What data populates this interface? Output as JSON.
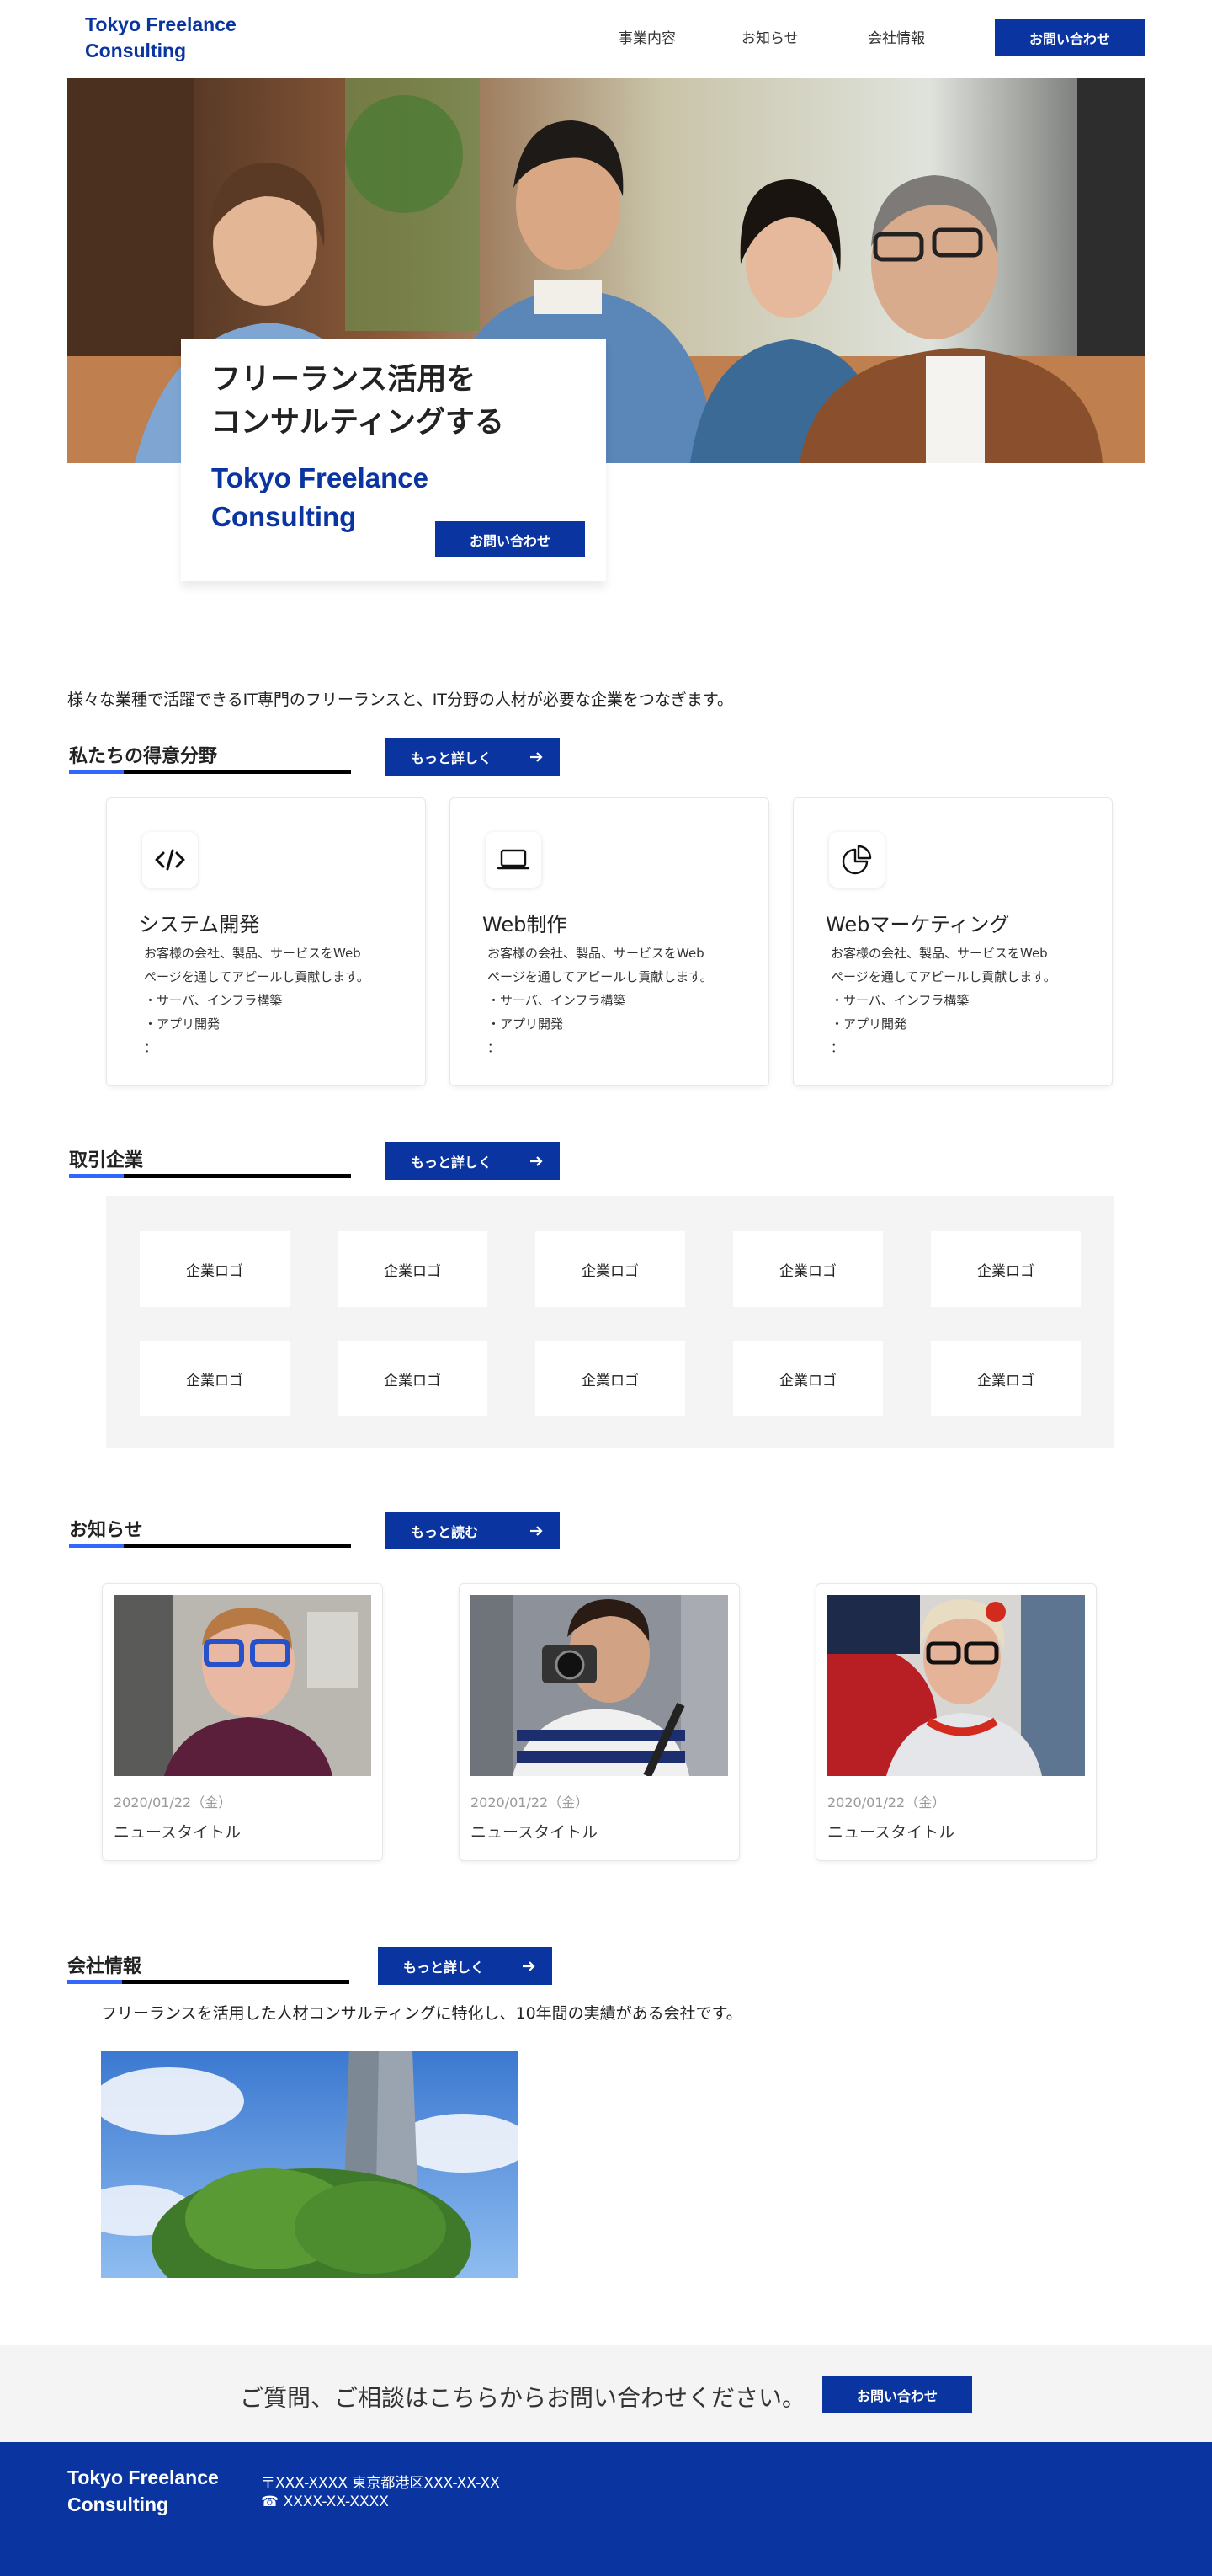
{
  "header": {
    "brand_line1": "Tokyo Freelance",
    "brand_line2": "Consulting",
    "nav": [
      "事業内容",
      "お知らせ",
      "会社情報"
    ],
    "contact_button": "お問い合わせ"
  },
  "hero": {
    "headline_line1": "フリーランス活用を",
    "headline_line2": "コンサルティングする",
    "brand_line1": "Tokyo Freelance",
    "brand_line2": "Consulting",
    "contact_button": "お問い合わせ"
  },
  "intro": "様々な業種で活躍できるIT専門のフリーランスと、IT分野の人材が必要な企業をつなぎます。",
  "services": {
    "title": "私たちの得意分野",
    "more_button": "もっと詳しく",
    "items": [
      {
        "icon": "code-icon",
        "title": "システム開発",
        "desc1": "お客様の会社、製品、サービスをWeb",
        "desc2": "ページを通してアピールし貢献します。",
        "bullet1": "・サーバ、インフラ構築",
        "bullet2": "・アプリ開発",
        "more": "："
      },
      {
        "icon": "laptop-icon",
        "title": "Web制作",
        "desc1": "お客様の会社、製品、サービスをWeb",
        "desc2": "ページを通してアピールし貢献します。",
        "bullet1": "・サーバ、インフラ構築",
        "bullet2": "・アプリ開発",
        "more": "："
      },
      {
        "icon": "pie-chart-icon",
        "title": "Webマーケティング",
        "desc1": "お客様の会社、製品、サービスをWeb",
        "desc2": "ページを通してアピールし貢献します。",
        "bullet1": "・サーバ、インフラ構築",
        "bullet2": "・アプリ開発",
        "more": "："
      }
    ]
  },
  "clients": {
    "title": "取引企業",
    "more_button": "もっと詳しく",
    "logos": [
      "企業ロゴ",
      "企業ロゴ",
      "企業ロゴ",
      "企業ロゴ",
      "企業ロゴ",
      "企業ロゴ",
      "企業ロゴ",
      "企業ロゴ",
      "企業ロゴ",
      "企業ロゴ"
    ]
  },
  "news": {
    "title": "お知らせ",
    "more_button": "もっと読む",
    "items": [
      {
        "date": "2020/01/22（金）",
        "title": "ニュースタイトル"
      },
      {
        "date": "2020/01/22（金）",
        "title": "ニュースタイトル"
      },
      {
        "date": "2020/01/22（金）",
        "title": "ニュースタイトル"
      }
    ]
  },
  "company": {
    "title": "会社情報",
    "more_button": "もっと詳しく",
    "description": "フリーランスを活用した人材コンサルティングに特化し、10年間の実績がある会社です。"
  },
  "cta": {
    "text": "ご質問、ご相談はこちらからお問い合わせください。",
    "button": "お問い合わせ"
  },
  "footer": {
    "brand_line1": "Tokyo Freelance",
    "brand_line2": "Consulting",
    "address": "〒XXX-XXXX 東京都港区XXX-XX-XX",
    "phone": "☎ XXXX-XX-XXXX"
  },
  "colors": {
    "brand_blue": "#0a35a0",
    "accent_blue": "#3366ff",
    "light_gray": "#f4f4f4"
  }
}
